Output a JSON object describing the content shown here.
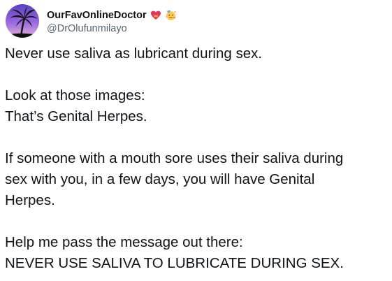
{
  "author": {
    "display_name": "OurFavOnlineDoctor",
    "handle": "@DrOlufunmilayo",
    "badges": [
      "heart-with-ribbon-emoji",
      "partying-face-emoji"
    ]
  },
  "tweet": {
    "line1": "Never use saliva as lubricant during sex.",
    "line2": "Look at those images:",
    "line3": "That’s Genital Herpes.",
    "line4": "If someone with a mouth sore uses their saliva during",
    "line5": "sex with you, in a few days, you will have Genital",
    "line6": "Herpes.",
    "line7": "Help me pass the message out there:",
    "line8": "NEVER USE SALIVA TO LUBRICATE DURING SEX."
  },
  "colors": {
    "text": "#0f1419",
    "secondary": "#536471",
    "avatar_bg": "#7a55d6"
  }
}
